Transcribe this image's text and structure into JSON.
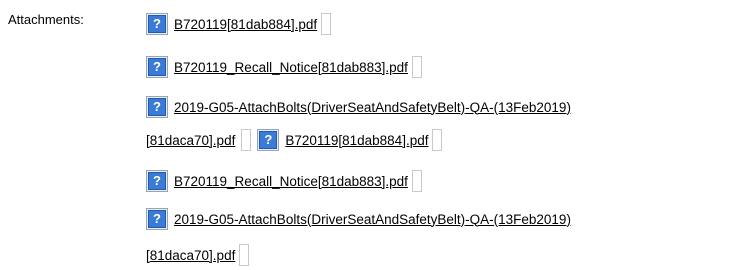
{
  "attachments_label": "Attachments:",
  "icon_glyph": "?",
  "items": [
    {
      "filename": "B720119[81dab884].pdf",
      "icon": "help-question-icon"
    },
    {
      "filename": "B720119_Recall_Notice[81dab883].pdf",
      "icon": "help-question-icon"
    },
    {
      "filename_part1": "2019-G05-AttachBolts(DriverSeatAndSafetyBelt)-QA-(13Feb2019)",
      "filename_part2": "[81daca70].pdf",
      "icon": "help-question-icon"
    },
    {
      "filename": "B720119[81dab884].pdf",
      "icon": "help-question-icon"
    },
    {
      "filename": "B720119_Recall_Notice[81dab883].pdf",
      "icon": "help-question-icon"
    },
    {
      "filename_part1": "2019-G05-AttachBolts(DriverSeatAndSafetyBelt)-QA-(13Feb2019)",
      "filename_part2": "[81daca70].pdf",
      "icon": "help-question-icon"
    }
  ]
}
